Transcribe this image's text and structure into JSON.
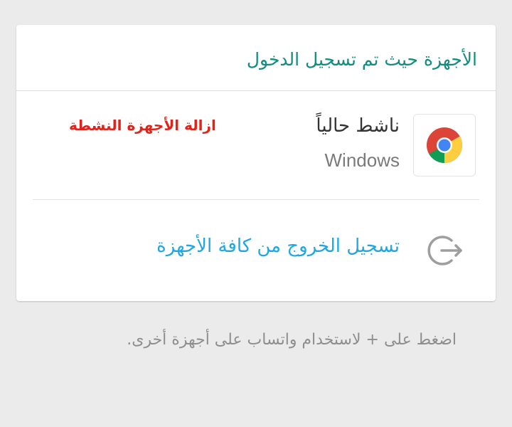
{
  "card": {
    "title": "الأجهزة حيث تم تسجيل الدخول"
  },
  "device": {
    "icon": "chrome-icon",
    "status": "ناشط حالياً",
    "os": "Windows"
  },
  "annotation": {
    "remove_active": "ازالة الأجهزة النشطة"
  },
  "logout": {
    "icon": "logout-icon",
    "label": "تسجيل الخروج من كافة الأجهزة"
  },
  "footer": {
    "hint": "اضغط على + لاستخدام واتساب على أجهزة أخرى."
  },
  "colors": {
    "title": "#128c7e",
    "link": "#1fa7e3",
    "annotation": "#e0241b",
    "background": "#ebebeb"
  }
}
